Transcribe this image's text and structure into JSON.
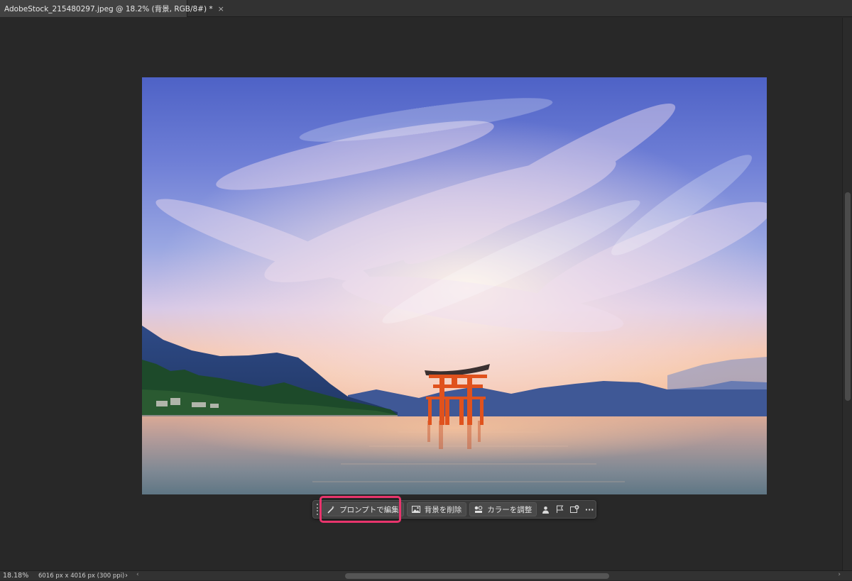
{
  "tab": {
    "title": "AdobeStock_215480297.jpeg @ 18.2% (背景, RGB/8#) *",
    "close_glyph": "×"
  },
  "taskbar": {
    "prompt_edit_label": "プロンプトで編集",
    "remove_bg_label": "背景を削除",
    "adjust_color_label": "カラーを調整",
    "more_glyph": "···"
  },
  "status": {
    "zoom": "18.18%",
    "doc_info": "6016 px x 4016 px (300 ppi)",
    "arrow": "›"
  },
  "icons": {
    "prompt": "wand-sparkle-icon",
    "remove_bg": "image-icon",
    "adjust_color": "color-adjust-icon",
    "select_subject": "person-icon",
    "crop": "flag-icon",
    "transform": "generate-icon"
  },
  "colors": {
    "highlight": "#e8356d",
    "torii": "#e0521d",
    "sky_top": "#4d66c9"
  }
}
